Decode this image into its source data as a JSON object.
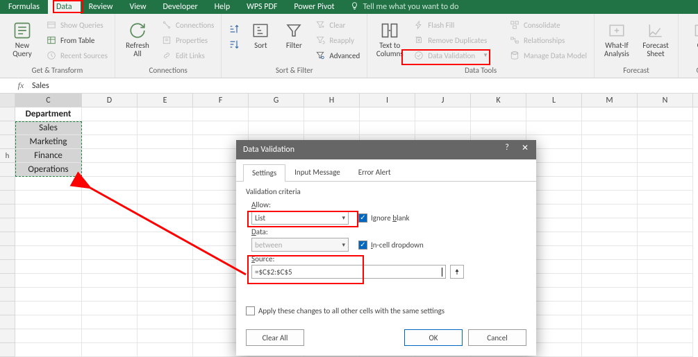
{
  "tabs": {
    "items": [
      "Formulas",
      "Data",
      "Review",
      "View",
      "Developer",
      "Help",
      "WPS PDF",
      "Power Pivot"
    ],
    "active": "Data",
    "tell_me_label": "Tell me what you want to do"
  },
  "ribbon": {
    "get_transform": {
      "new_query": "New\nQuery",
      "show_queries": "Show Queries",
      "from_table": "From Table",
      "recent_sources": "Recent Sources",
      "group_label": "Get & Transform"
    },
    "connections_grp": {
      "refresh_all": "Refresh\nAll",
      "connections": "Connections",
      "properties": "Properties",
      "edit_links": "Edit Links",
      "group_label": "Connections"
    },
    "sort_filter": {
      "sort": "Sort",
      "filter": "Filter",
      "clear": "Clear",
      "reapply": "Reapply",
      "advanced": "Advanced",
      "group_label": "Sort & Filter"
    },
    "data_tools": {
      "text_to_columns": "Text to\nColumns",
      "flash_fill": "Flash Fill",
      "remove_duplicates": "Remove Duplicates",
      "data_validation": "Data Validation",
      "consolidate": "Consolidate",
      "relationships": "Relationships",
      "manage_data_model": "Manage Data Model",
      "group_label": "Data Tools"
    },
    "forecast": {
      "what_if": "What-If\nAnalysis",
      "forecast_sheet": "Forecast\nSheet",
      "group_label": "Forecast"
    },
    "outline": {
      "group": "Gr",
      "group_label": "Ou"
    }
  },
  "formula_bar_value": "Sales",
  "department_header": "Department",
  "departments": [
    "Sales",
    "Marketing",
    "Finance",
    "Operations"
  ],
  "col_letters": [
    "C",
    "D",
    "E",
    "F",
    "G",
    "H",
    "I",
    "J",
    "K",
    "L",
    "M",
    "N"
  ],
  "row_letter_partial": "h",
  "dialog": {
    "title": "Data Validation",
    "tabs": [
      "Settings",
      "Input Message",
      "Error Alert"
    ],
    "active_tab": "Settings",
    "criteria_label": "Validation criteria",
    "allow_label": "Allow:",
    "allow_value": "List",
    "data_label": "Data:",
    "data_value": "between",
    "source_label": "Source:",
    "source_value": "=$C$2:$C$5",
    "ignore_blank": "Ignore blank",
    "in_cell_dropdown": "In-cell dropdown",
    "apply_same": "Apply these changes to all other cells with the same settings",
    "clear_all": "Clear All",
    "ok": "OK",
    "cancel": "Cancel"
  }
}
